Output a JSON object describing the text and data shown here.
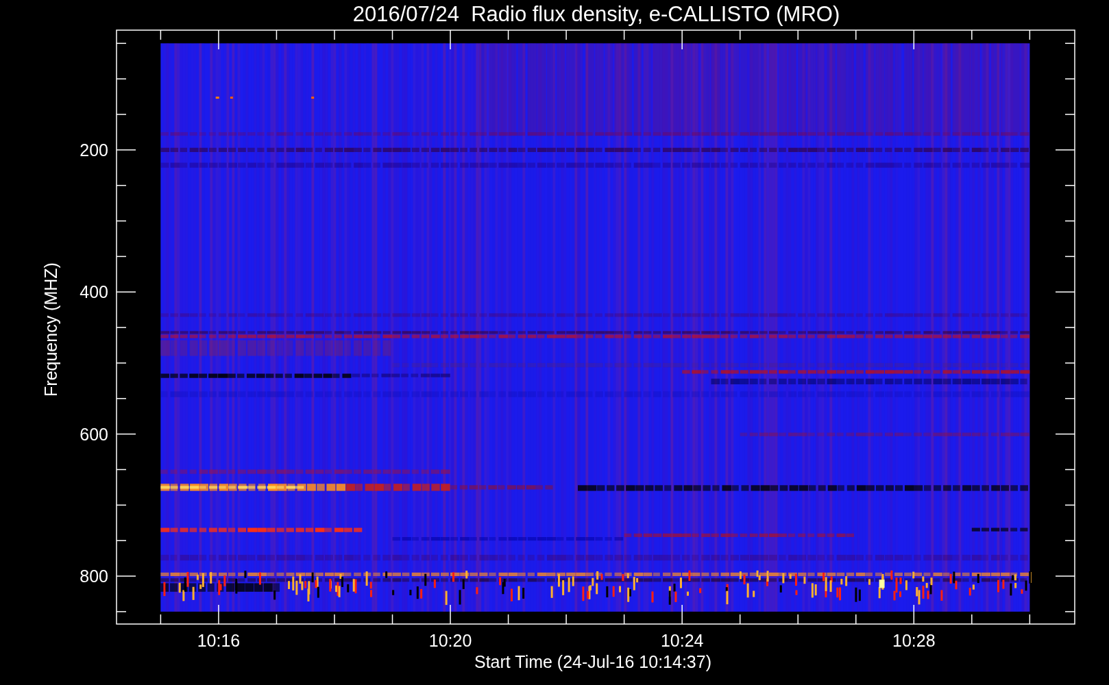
{
  "title": "2016/07/24  Radio flux density, e-CALLISTO (MRO)",
  "y_axis": {
    "label": "Frequency (MHZ)",
    "ticks": [
      "200",
      "400",
      "600",
      "800"
    ]
  },
  "x_axis": {
    "label": "Start Time (24-Jul-16 10:14:37)",
    "ticks": [
      "10:16",
      "10:20",
      "10:24",
      "10:28"
    ]
  }
}
